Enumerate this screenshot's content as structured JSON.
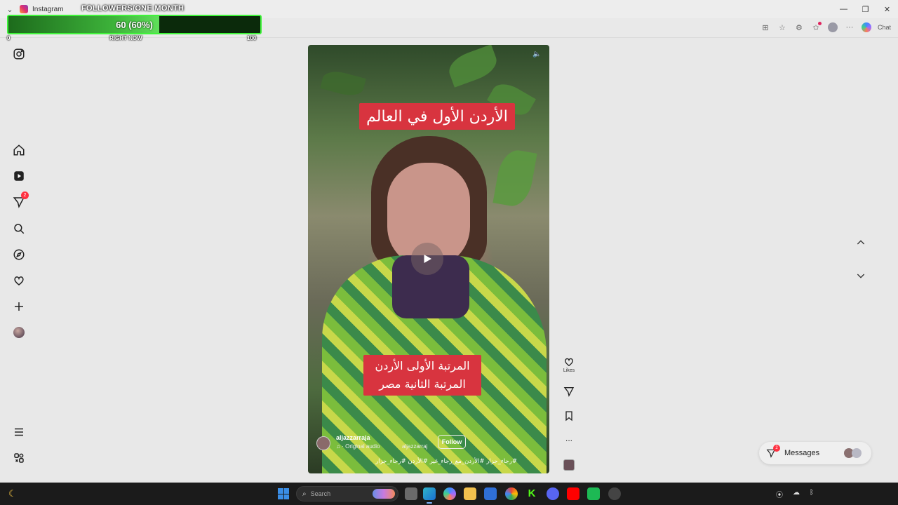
{
  "window": {
    "title": "Instagram",
    "chat_label": "Chat"
  },
  "overlay": {
    "title": "FOLLOWERS/ONE MONTH",
    "progress_text": "60 (60%)",
    "progress_fraction": 0.6,
    "min_label": "0",
    "center_label": "RIGHT NOW",
    "max_label": "100"
  },
  "nav": {
    "notifications_badge": "2"
  },
  "reel": {
    "caption_top": "الأردن الأول في العالم",
    "caption_bottom_line1": "المرتبة الأولى الأردن",
    "caption_bottom_line2": "المرتبة الثانية مصر",
    "username": "aljazzarraja",
    "audio_label": "· Original audio",
    "audio_user": "aljazzarraj",
    "follow_label": "Follow",
    "hashtags": "#رجاء_جزار #الأردن_مع_رجاء_غير #الأردن #رجاء_جزار"
  },
  "actions": {
    "likes_label": "Likes",
    "more_label": "..."
  },
  "messages": {
    "label": "Messages",
    "badge": "2"
  },
  "taskbar": {
    "search_placeholder": "Search"
  },
  "colors": {
    "progress_border": "#3ff43a",
    "caption_bg": "#d8343f",
    "badge": "#ff3040"
  }
}
